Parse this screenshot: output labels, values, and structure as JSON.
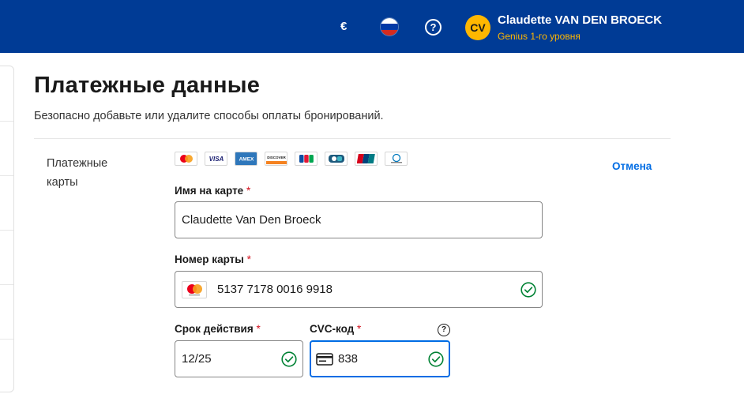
{
  "header": {
    "currency": "€",
    "user_name": "Claudette VAN DEN BROECK",
    "user_level": "Genius 1-го уровня",
    "avatar_initials": "CV",
    "help_glyph": "?",
    "colors": {
      "bar": "#003b95",
      "accent": "#ffb700"
    },
    "language_flag": "russia-flag-icon"
  },
  "page": {
    "title": "Платежные данные",
    "subtitle": "Безопасно добавьте или удалите способы оплаты бронирований."
  },
  "payment_cards": {
    "section_label": "Платежные карты",
    "cancel_label": "Отмена",
    "accepted_brands": [
      "mastercard-icon",
      "visa-icon",
      "amex-icon",
      "discover-icon",
      "jcb-icon",
      "cartes-bancaires-icon",
      "unionpay-icon",
      "diners-club-icon"
    ],
    "card_name": {
      "label": "Имя на карте",
      "required_mark": "*",
      "value": "Claudette Van Den Broeck"
    },
    "card_number": {
      "label": "Номер карты",
      "required_mark": "*",
      "value": "5137 7178 0016 9918",
      "brand": "mastercard-icon",
      "valid": true
    },
    "expiry": {
      "label": "Срок действия",
      "required_mark": "*",
      "value": "12/25",
      "valid": true
    },
    "cvc": {
      "label": "CVC-код",
      "required_mark": "*",
      "value": "838",
      "valid": true,
      "help_glyph": "?"
    }
  }
}
